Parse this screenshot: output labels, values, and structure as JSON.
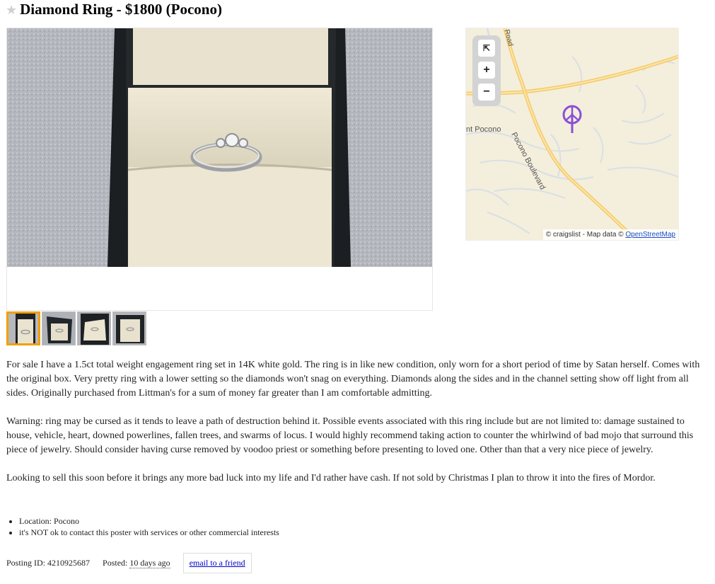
{
  "header": {
    "title": "Diamond Ring - $1800 (Pocono)"
  },
  "gallery": {
    "thumb_count": 4,
    "selected_index": 0
  },
  "map": {
    "labels": {
      "road": "Road",
      "town": "nt Pocono",
      "boulevard": "Pocono Boulevard"
    },
    "controls": {
      "zoom_in": "+",
      "zoom_out": "−"
    },
    "attribution_prefix": "© craigslist - Map data © ",
    "attribution_link": "OpenStreetMap",
    "marker_color": "#8a4fd6"
  },
  "body": {
    "paragraphs": [
      "For sale I have a 1.5ct total weight engagement ring set in 14K white gold. The ring is in like new condition, only worn for a short period of time by Satan herself. Comes with the original box. Very pretty ring with a lower setting so the diamonds won't snag on everything. Diamonds along the sides and in the channel setting show off light from all sides. Originally purchased from Littman's for a sum of money far greater than I am comfortable admitting.",
      "Warning: ring may be cursed as it tends to leave a path of destruction behind it. Possible events associated with this ring include but are not limited to: damage sustained to house, vehicle, heart, downed powerlines, fallen trees, and swarms of locus. I would highly recommend taking action to counter the whirlwind of bad mojo that surround this piece of jewelry. Should consider having curse removed by voodoo priest or something before presenting to loved one. Other than that a very nice piece of jewelry.",
      "Looking to sell this soon before it brings any more bad luck into my life and I'd rather have cash. If not sold by Christmas I plan to throw it into the fires of Mordor."
    ]
  },
  "notices": {
    "location": "Location: Pocono",
    "no_contact": "it's NOT ok to contact this poster with services or other commercial interests"
  },
  "postinginfo": {
    "posting_id": "Posting ID: 4210925687",
    "posted_label": "Posted: ",
    "posted_value": "10 days ago",
    "email_friend": "email to a friend"
  },
  "colors": {
    "thumb_selected_border": "#f0a000",
    "road_major": "#f5c96a",
    "map_bg": "#f3efdc"
  }
}
